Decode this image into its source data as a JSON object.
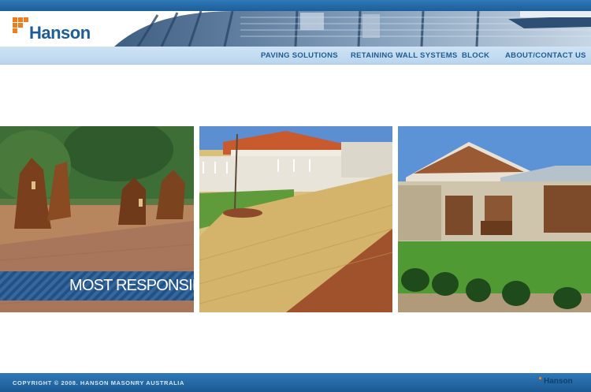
{
  "brand": {
    "name": "Hanson",
    "accent": "#f07d1a",
    "primary": "#1d5e98"
  },
  "nav": {
    "items": [
      {
        "label": "PAVING SOLUTIONS"
      },
      {
        "label": "RETAINING WALL SYSTEMS"
      },
      {
        "label": "BLOCK"
      },
      {
        "label": "ABOUT/CONTACT US"
      }
    ]
  },
  "gallery": {
    "banner_text": "MOST RESPONSIBLE",
    "photos": [
      {
        "icon": "sculpture-plaza-photo"
      },
      {
        "icon": "paved-driveway-photo"
      },
      {
        "icon": "house-garden-photo"
      }
    ]
  },
  "footer": {
    "copyright": "COPYRIGHT © 2008. HANSON MASONRY AUSTRALIA",
    "logo": "Hanson"
  }
}
